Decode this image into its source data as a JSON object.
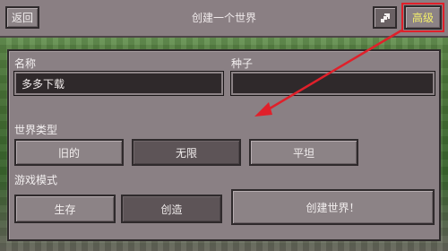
{
  "header": {
    "back_label": "返回",
    "title": "创建一个世界",
    "tool_icon": "wrench-icon",
    "advanced_label": "高级"
  },
  "form": {
    "name_label": "名称",
    "name_value": "多多下载",
    "seed_label": "种子",
    "seed_value": "",
    "world_type_label": "世界类型",
    "world_types": [
      "旧的",
      "无限",
      "平坦"
    ],
    "world_type_selected": "无限",
    "game_mode_label": "游戏模式",
    "game_modes": [
      "生存",
      "创造"
    ],
    "game_mode_selected": "创造",
    "create_label": "创建世界！"
  },
  "annotation": {
    "highlight_color": "#e0202a"
  }
}
